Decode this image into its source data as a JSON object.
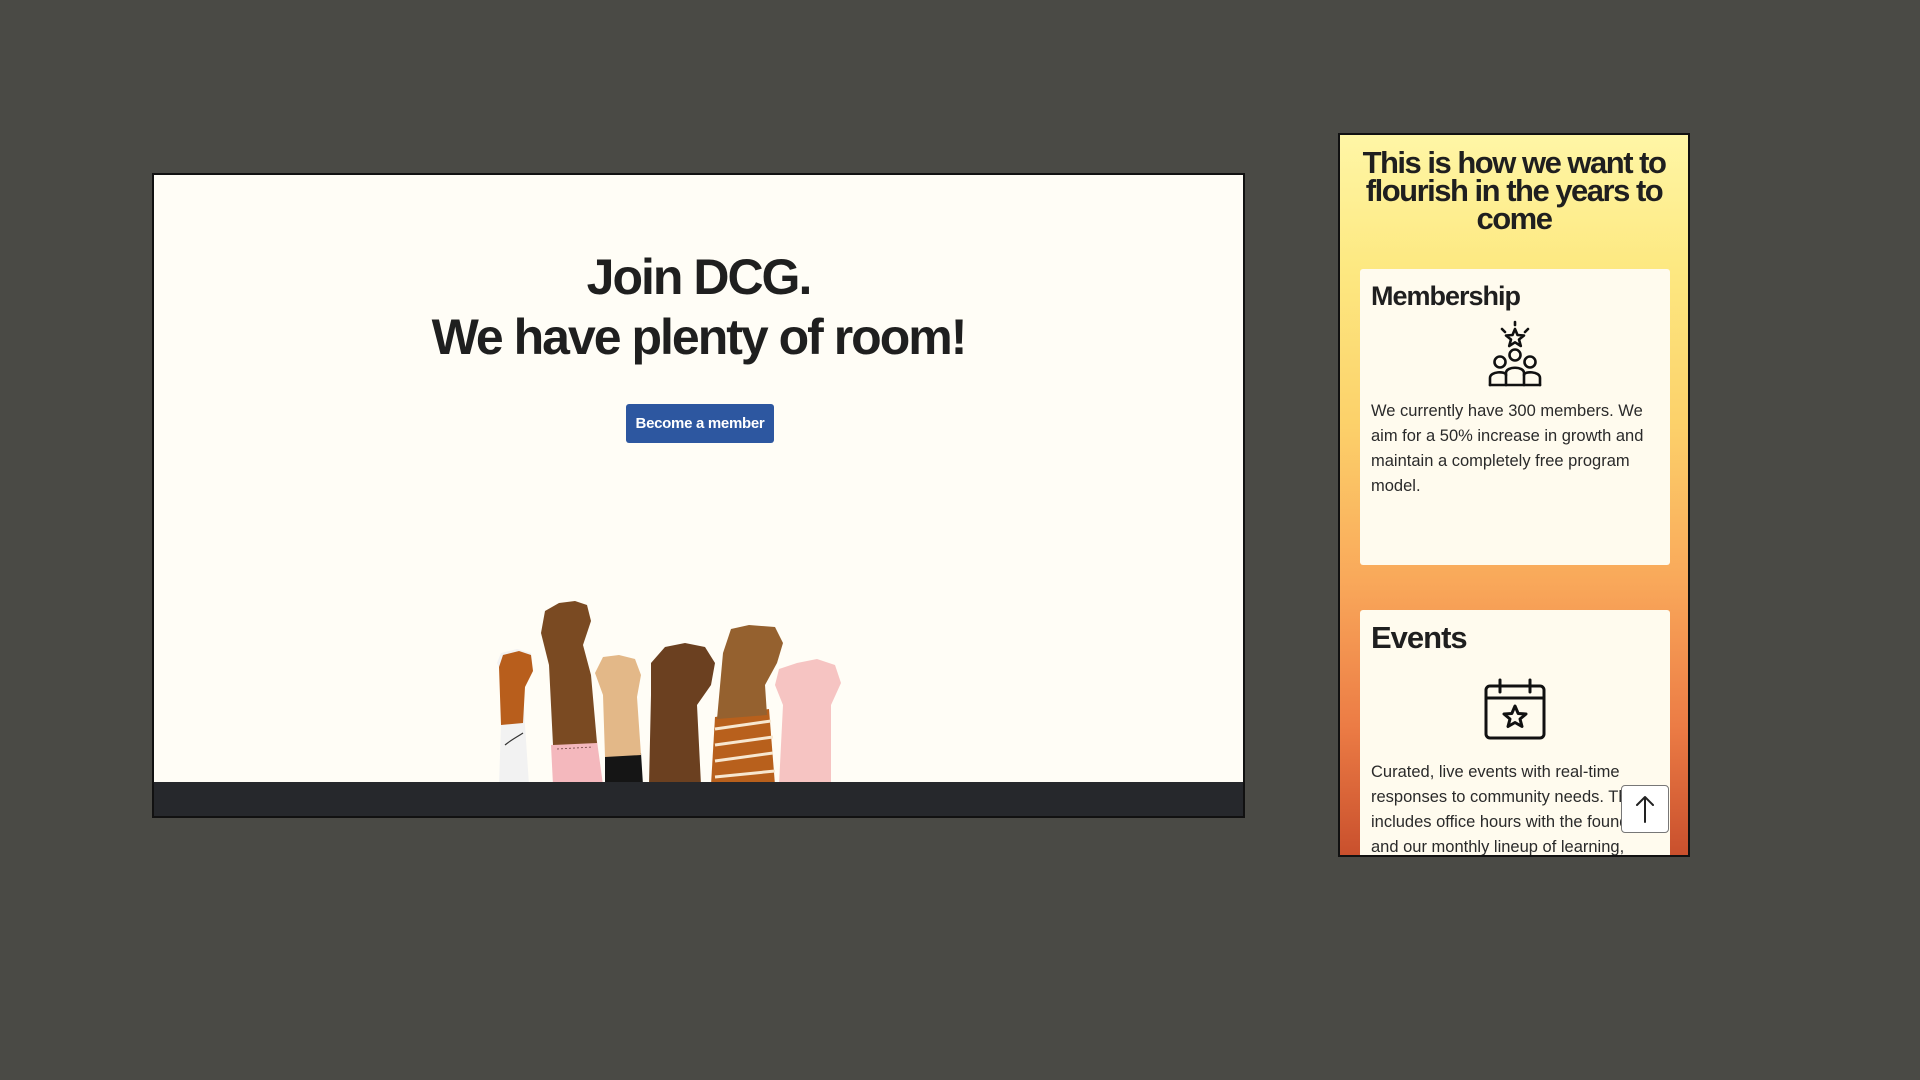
{
  "desktop": {
    "hero": {
      "title_line1": "Join DCG.",
      "title_line2": "We have plenty of room!",
      "cta_label": "Become a member"
    }
  },
  "mobile": {
    "heading": "This is how we want to flourish in the years to come",
    "cards": [
      {
        "title": "Membership",
        "icon": "community-star-icon",
        "body": "We currently have 300 members. We aim for a 50% increase in growth and maintain a completely free program model."
      },
      {
        "title": "Events",
        "icon": "calendar-star-icon",
        "body": "Curated, live events with real-time responses to community needs. This includes office hours with the founders and our monthly lineup of learning,"
      }
    ],
    "scroll_top_icon": "arrow-up-icon"
  },
  "colors": {
    "background": "#4a4a45",
    "cta": "#2d57a0",
    "page": "#fffdf6",
    "card": "#fffbee",
    "footer": "#26282c"
  }
}
